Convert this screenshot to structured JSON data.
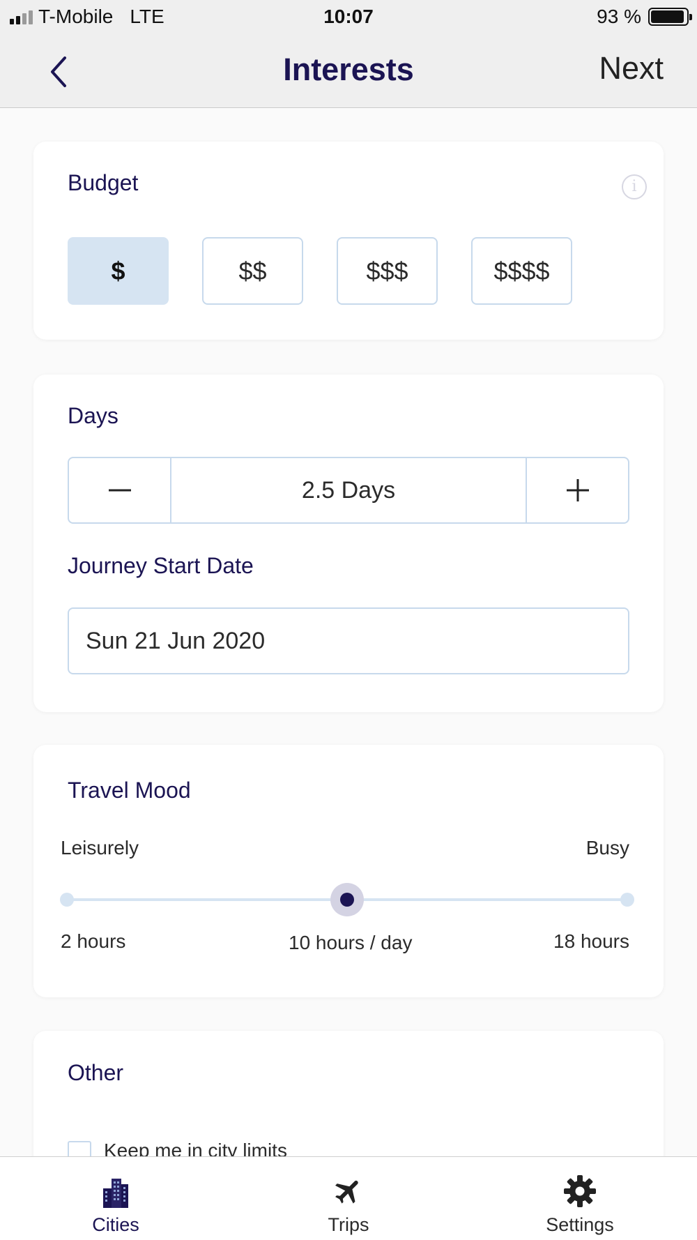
{
  "status_bar": {
    "carrier": "T-Mobile",
    "network": "LTE",
    "time": "10:07",
    "battery": "93 %",
    "battery_level": 0.93
  },
  "nav": {
    "title": "Interests",
    "next_label": "Next",
    "back_icon": "chevron-left-icon"
  },
  "budget": {
    "title": "Budget",
    "info_icon": "info-icon",
    "info_glyph": "i",
    "options": [
      "$",
      "$$",
      "$$$",
      "$$$$"
    ],
    "selected": "$"
  },
  "days": {
    "title": "Days",
    "value": "2.5 Days",
    "start_date_title": "Journey Start Date",
    "start_date_value": "Sun 21 Jun 2020"
  },
  "travel_mood": {
    "title": "Travel Mood",
    "left_label": "Leisurely",
    "right_label": "Busy",
    "min_label": "2 hours",
    "current_label": "10 hours / day",
    "max_label": "18 hours",
    "min_value": 2,
    "max_value": 18,
    "current_value": 10
  },
  "other": {
    "title": "Other",
    "city_limits_label": "Keep me in city limits",
    "city_limits_checked": false
  },
  "tabs": [
    {
      "label": "Cities",
      "icon": "buildings-icon",
      "active": true
    },
    {
      "label": "Trips",
      "icon": "airplane-icon",
      "active": false
    },
    {
      "label": "Settings",
      "icon": "gear-icon",
      "active": false
    }
  ],
  "colors": {
    "accent": "#1b1453",
    "selected_bg": "#d6e4f2",
    "border": "#c7d9ec"
  }
}
